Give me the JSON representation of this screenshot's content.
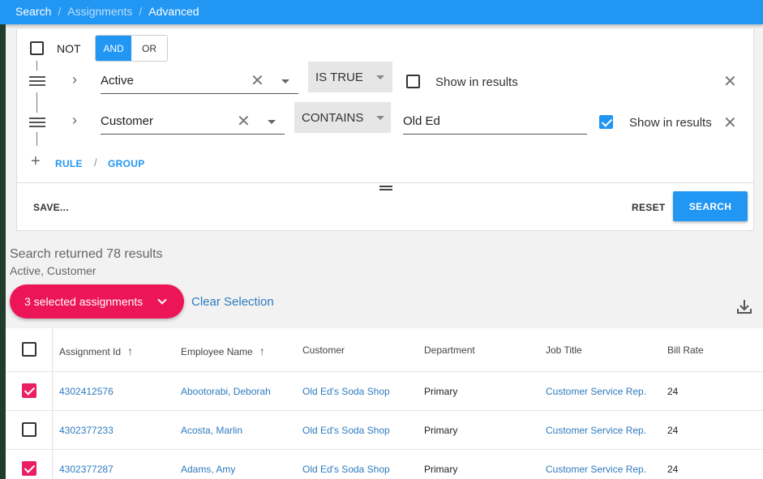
{
  "breadcrumb": {
    "items": [
      "Search",
      "Assignments",
      "Advanced"
    ],
    "separator": "/"
  },
  "query": {
    "not_label": "NOT",
    "logic": {
      "and": "AND",
      "or": "OR",
      "selected": "AND"
    },
    "rules": [
      {
        "field": "Active",
        "operator": "IS TRUE",
        "value": "",
        "show_in_results": false,
        "show_label": "Show in results"
      },
      {
        "field": "Customer",
        "operator": "CONTAINS",
        "value": "Old Ed",
        "show_in_results": true,
        "show_label": "Show in results"
      }
    ],
    "add_rule": "RULE",
    "add_sep": "/",
    "add_group": "GROUP"
  },
  "actions": {
    "save": "SAVE...",
    "reset": "RESET",
    "search": "SEARCH"
  },
  "results": {
    "title": "Search returned 78 results",
    "subtitle": "Active, Customer",
    "selection_label": "3 selected assignments",
    "clear_label": "Clear Selection"
  },
  "table": {
    "columns": [
      "Assignment Id",
      "Employee Name",
      "Customer",
      "Department",
      "Job Title",
      "Bill Rate"
    ],
    "rows": [
      {
        "checked": true,
        "id": "4302412576",
        "name": "Abootorabi, Deborah",
        "customer": "Old Ed's Soda Shop",
        "dept": "Primary",
        "job": "Customer Service Rep.",
        "rate": "24"
      },
      {
        "checked": false,
        "id": "4302377233",
        "name": "Acosta, Marlin",
        "customer": "Old Ed's Soda Shop",
        "dept": "Primary",
        "job": "Customer Service Rep.",
        "rate": "24"
      },
      {
        "checked": true,
        "id": "4302377287",
        "name": "Adams, Amy",
        "customer": "Old Ed's Soda Shop",
        "dept": "Primary",
        "job": "Customer Service Rep.",
        "rate": "24"
      }
    ]
  },
  "colors": {
    "primary": "#2196f3",
    "accent": "#ec1557",
    "link": "#2e7bbf"
  }
}
